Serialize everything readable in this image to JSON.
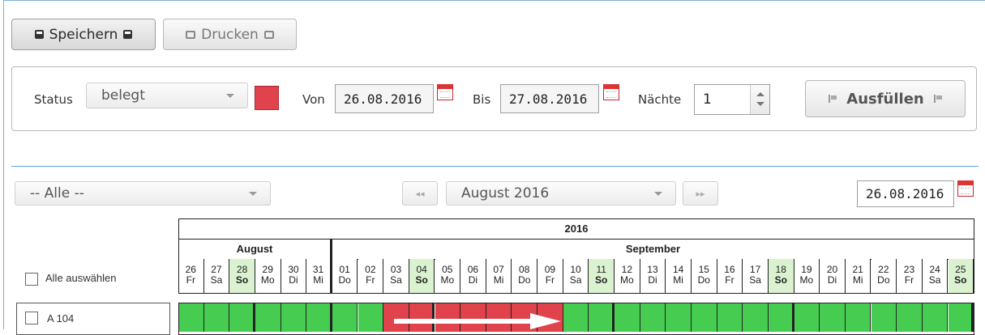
{
  "toolbar": {
    "save_label": "Speichern",
    "print_label": "Drucken"
  },
  "filter": {
    "status_label": "Status",
    "status_value": "belegt",
    "status_color": "#e0434b",
    "from_label": "Von",
    "from_value": "26.08.2016",
    "to_label": "Bis",
    "to_value": "27.08.2016",
    "nights_label": "Nächte",
    "nights_value": "1",
    "fill_label": "Ausfüllen"
  },
  "calendar_nav": {
    "room_filter": "-- Alle --",
    "month_value": "August 2016",
    "date_value": "26.08.2016"
  },
  "calendar": {
    "year": "2016",
    "months": [
      "August",
      "September"
    ],
    "select_all_label": "Alle auswählen",
    "days": [
      {
        "d": "26",
        "w": "Fr"
      },
      {
        "d": "27",
        "w": "Sa"
      },
      {
        "d": "28",
        "w": "So"
      },
      {
        "d": "29",
        "w": "Mo"
      },
      {
        "d": "30",
        "w": "Di"
      },
      {
        "d": "31",
        "w": "Mi"
      },
      {
        "d": "01",
        "w": "Do"
      },
      {
        "d": "02",
        "w": "Fr"
      },
      {
        "d": "03",
        "w": "Sa"
      },
      {
        "d": "04",
        "w": "So"
      },
      {
        "d": "05",
        "w": "Mo"
      },
      {
        "d": "06",
        "w": "Di"
      },
      {
        "d": "07",
        "w": "Mi"
      },
      {
        "d": "08",
        "w": "Do"
      },
      {
        "d": "09",
        "w": "Fr"
      },
      {
        "d": "10",
        "w": "Sa"
      },
      {
        "d": "11",
        "w": "So"
      },
      {
        "d": "12",
        "w": "Mo"
      },
      {
        "d": "13",
        "w": "Di"
      },
      {
        "d": "14",
        "w": "Mi"
      },
      {
        "d": "15",
        "w": "Do"
      },
      {
        "d": "16",
        "w": "Fr"
      },
      {
        "d": "17",
        "w": "Sa"
      },
      {
        "d": "18",
        "w": "So"
      },
      {
        "d": "19",
        "w": "Mo"
      },
      {
        "d": "20",
        "w": "Di"
      },
      {
        "d": "21",
        "w": "Mi"
      },
      {
        "d": "22",
        "w": "Do"
      },
      {
        "d": "23",
        "w": "Fr"
      },
      {
        "d": "24",
        "w": "Sa"
      },
      {
        "d": "25",
        "w": "So"
      }
    ],
    "rooms": [
      {
        "name": "A 104",
        "occupied": [
          "03",
          "04",
          "05",
          "06",
          "07",
          "08",
          "09"
        ]
      }
    ],
    "colors": {
      "free": "#47cc52",
      "occupied": "#e0434b",
      "weekend_header": "#dbf2d0"
    }
  }
}
